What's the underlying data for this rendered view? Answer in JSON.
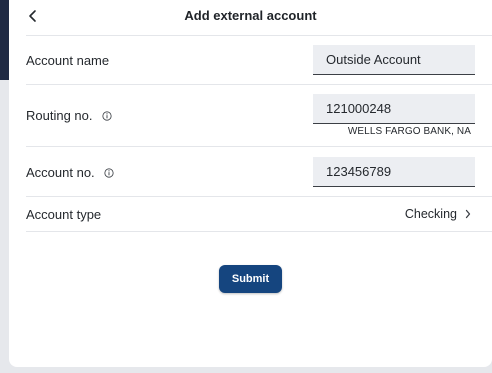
{
  "header": {
    "title": "Add external account",
    "back_icon": "chevron-left-icon"
  },
  "form": {
    "account_name": {
      "label": "Account name",
      "value": "Outside Account"
    },
    "routing": {
      "label": "Routing no.",
      "value": "121000248",
      "bank_name": "WELLS FARGO BANK, NA",
      "info_icon": "info-icon"
    },
    "account_no": {
      "label": "Account no.",
      "value": "123456789",
      "info_icon": "info-icon"
    },
    "account_type": {
      "label": "Account type",
      "value": "Checking",
      "chevron_icon": "chevron-right-icon"
    }
  },
  "actions": {
    "submit_label": "Submit"
  },
  "colors": {
    "primary": "#15457f",
    "field_bg": "#eceef2",
    "divider": "#e4e6ea",
    "sidebar_dark": "#1f2a44"
  }
}
